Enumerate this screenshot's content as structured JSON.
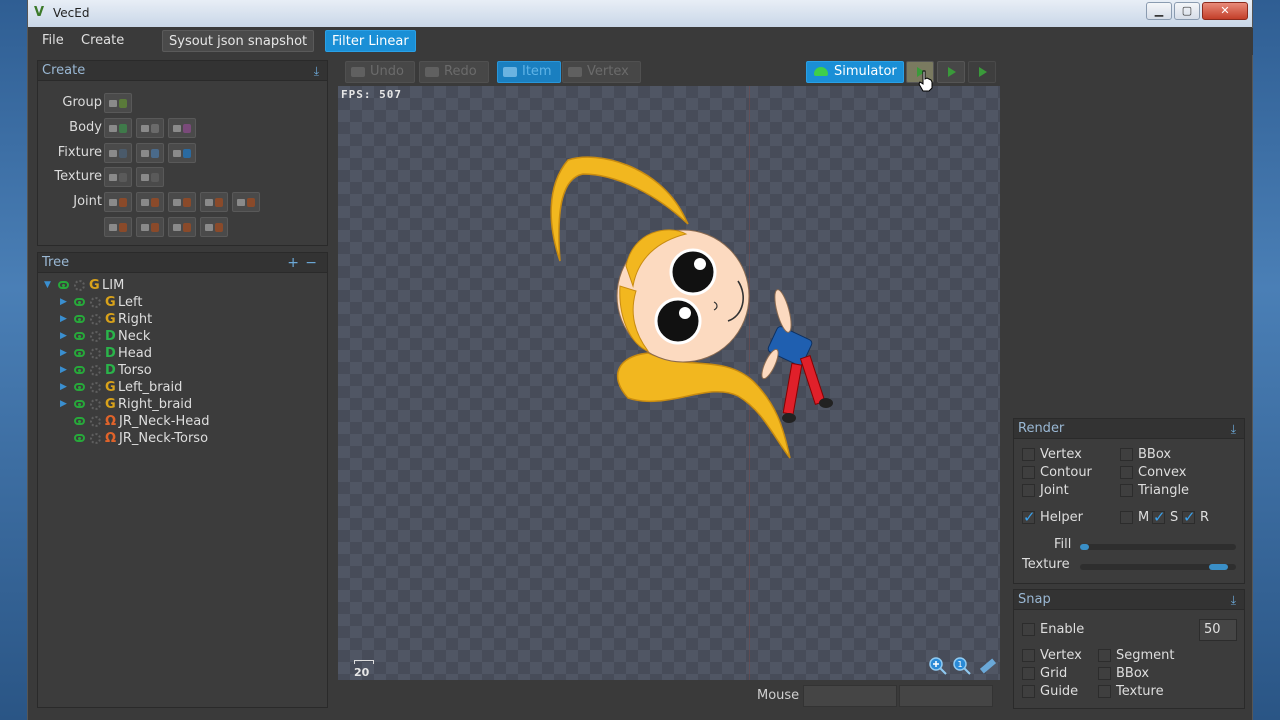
{
  "window": {
    "title": "VecEd",
    "controls": [
      "minimize",
      "maximize",
      "close"
    ]
  },
  "menubar": {
    "file": "File",
    "create": "Create",
    "sysout": "Sysout json snapshot",
    "filter": "Filter Linear"
  },
  "create_panel": {
    "title": "Create",
    "rows": [
      {
        "label": "Group"
      },
      {
        "label": "Body"
      },
      {
        "label": "Fixture"
      },
      {
        "label": "Texture"
      },
      {
        "label": "Joint"
      }
    ]
  },
  "tree_panel": {
    "title": "Tree",
    "items": [
      {
        "type": "G",
        "label": "LIM",
        "expanded": true
      },
      {
        "type": "G",
        "label": "Left"
      },
      {
        "type": "G",
        "label": "Right"
      },
      {
        "type": "D",
        "label": "Neck"
      },
      {
        "type": "D",
        "label": "Head"
      },
      {
        "type": "D",
        "label": "Torso"
      },
      {
        "type": "G",
        "label": "Left_braid"
      },
      {
        "type": "G",
        "label": "Right_braid"
      },
      {
        "type": "J",
        "label": "JR_Neck-Head"
      },
      {
        "type": "J",
        "label": "JR_Neck-Torso"
      }
    ]
  },
  "toolbar": {
    "undo": "Undo",
    "redo": "Redo",
    "item": "Item",
    "vertex": "Vertex",
    "simulator": "Simulator"
  },
  "viewport": {
    "fps": "FPS: 507",
    "scale": "20"
  },
  "statusbar": {
    "mouse": "Mouse"
  },
  "render_panel": {
    "title": "Render",
    "vertex": "Vertex",
    "bbox": "BBox",
    "contour": "Contour",
    "convex": "Convex",
    "joint": "Joint",
    "triangle": "Triangle",
    "helper": "Helper",
    "m": "M",
    "s": "S",
    "r": "R",
    "fill": "Fill",
    "texture": "Texture",
    "fill_value": 0.06,
    "texture_value": 0.95
  },
  "snap_panel": {
    "title": "Snap",
    "enable": "Enable",
    "value": "50",
    "vertex": "Vertex",
    "segment": "Segment",
    "grid": "Grid",
    "bbox": "BBox",
    "guide": "Guide",
    "texture": "Texture"
  },
  "colors": {
    "accent": "#1a8fd6",
    "group": "#d9a21a",
    "body": "#2ab44a",
    "joint": "#e0632a"
  }
}
